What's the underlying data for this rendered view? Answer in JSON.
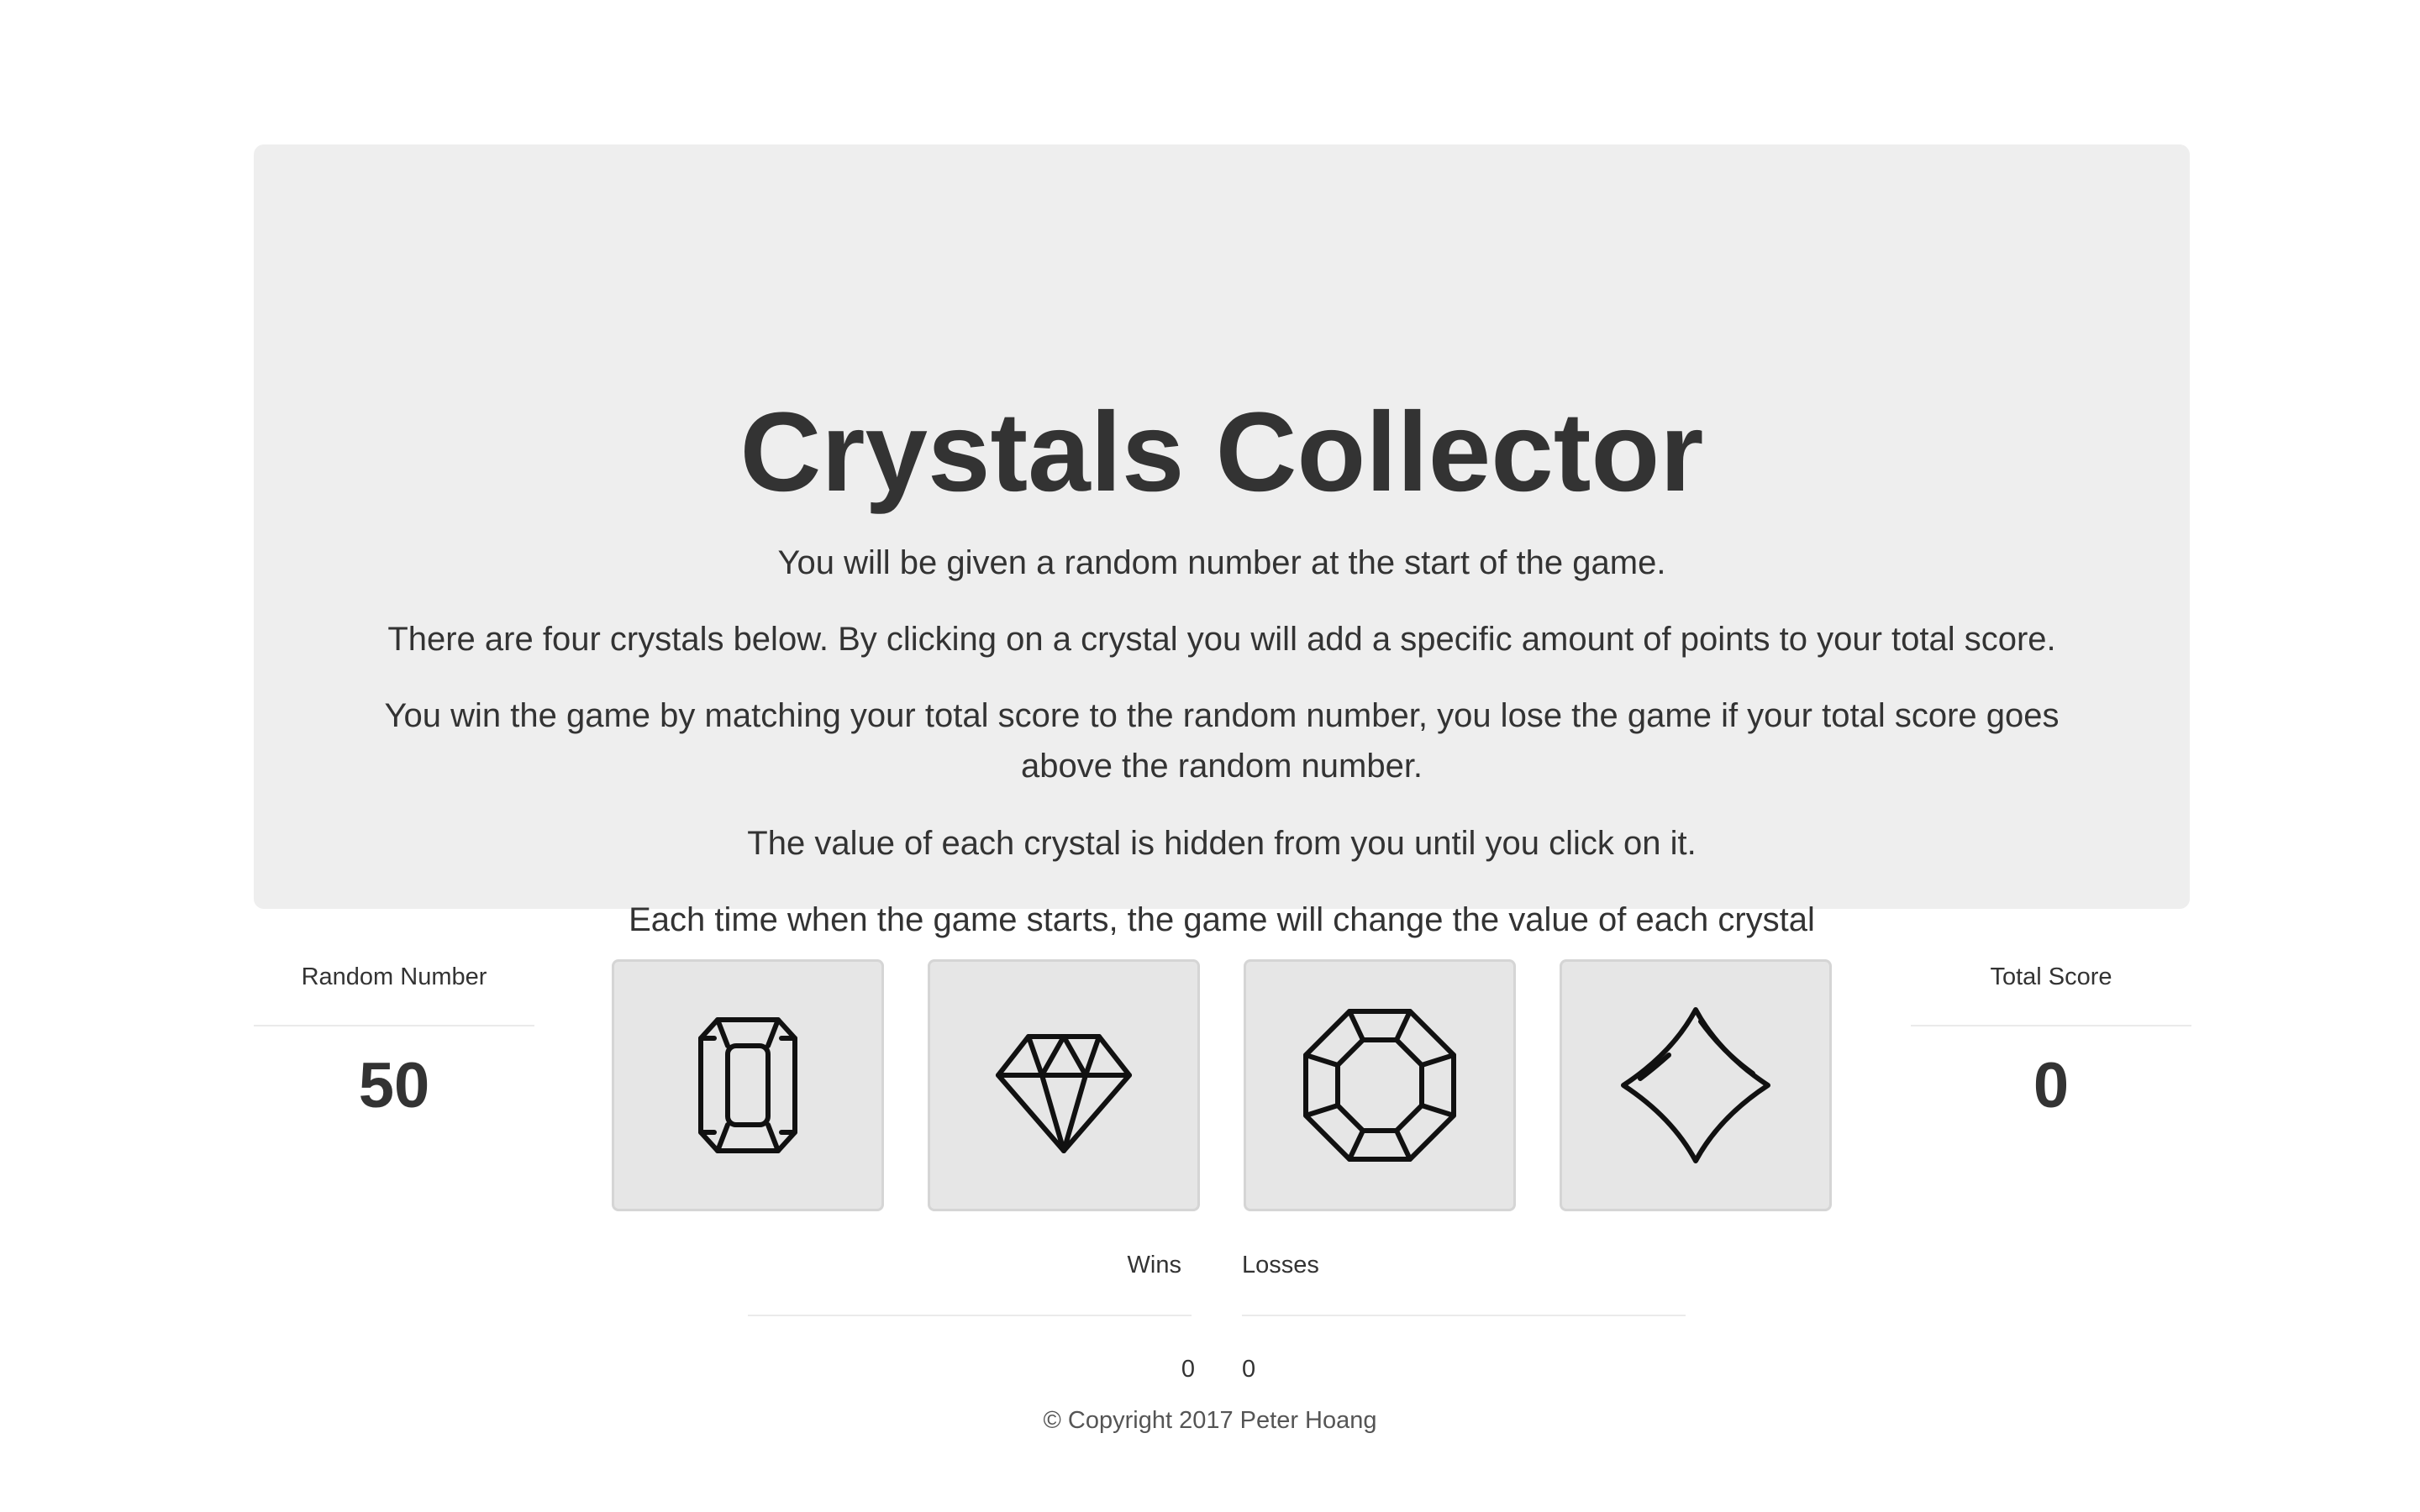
{
  "header": {
    "title": "Crystals Collector",
    "instructions": [
      "You will be given a random number at the start of the game.",
      "There are four crystals below. By clicking on a crystal you will add a specific amount of points to your total score.",
      "You win the game by matching your total score to the random number, you lose the game if your total score goes above the random number.",
      "The value of each crystal is hidden from you until you click on it.",
      "Each time when the game starts, the game will change the value of each crystal"
    ]
  },
  "random_number": {
    "label": "Random Number",
    "value": "50"
  },
  "total_score": {
    "label": "Total Score",
    "value": "0"
  },
  "crystals": [
    {
      "icon": "emerald-cut-gem-icon"
    },
    {
      "icon": "diamond-gem-icon"
    },
    {
      "icon": "octagon-gem-icon"
    },
    {
      "icon": "cushion-gem-icon"
    }
  ],
  "wins": {
    "label": "Wins",
    "value": "0"
  },
  "losses": {
    "label": "Losses",
    "value": "0"
  },
  "footer": {
    "copyright": "© Copyright 2017 Peter Hoang"
  }
}
